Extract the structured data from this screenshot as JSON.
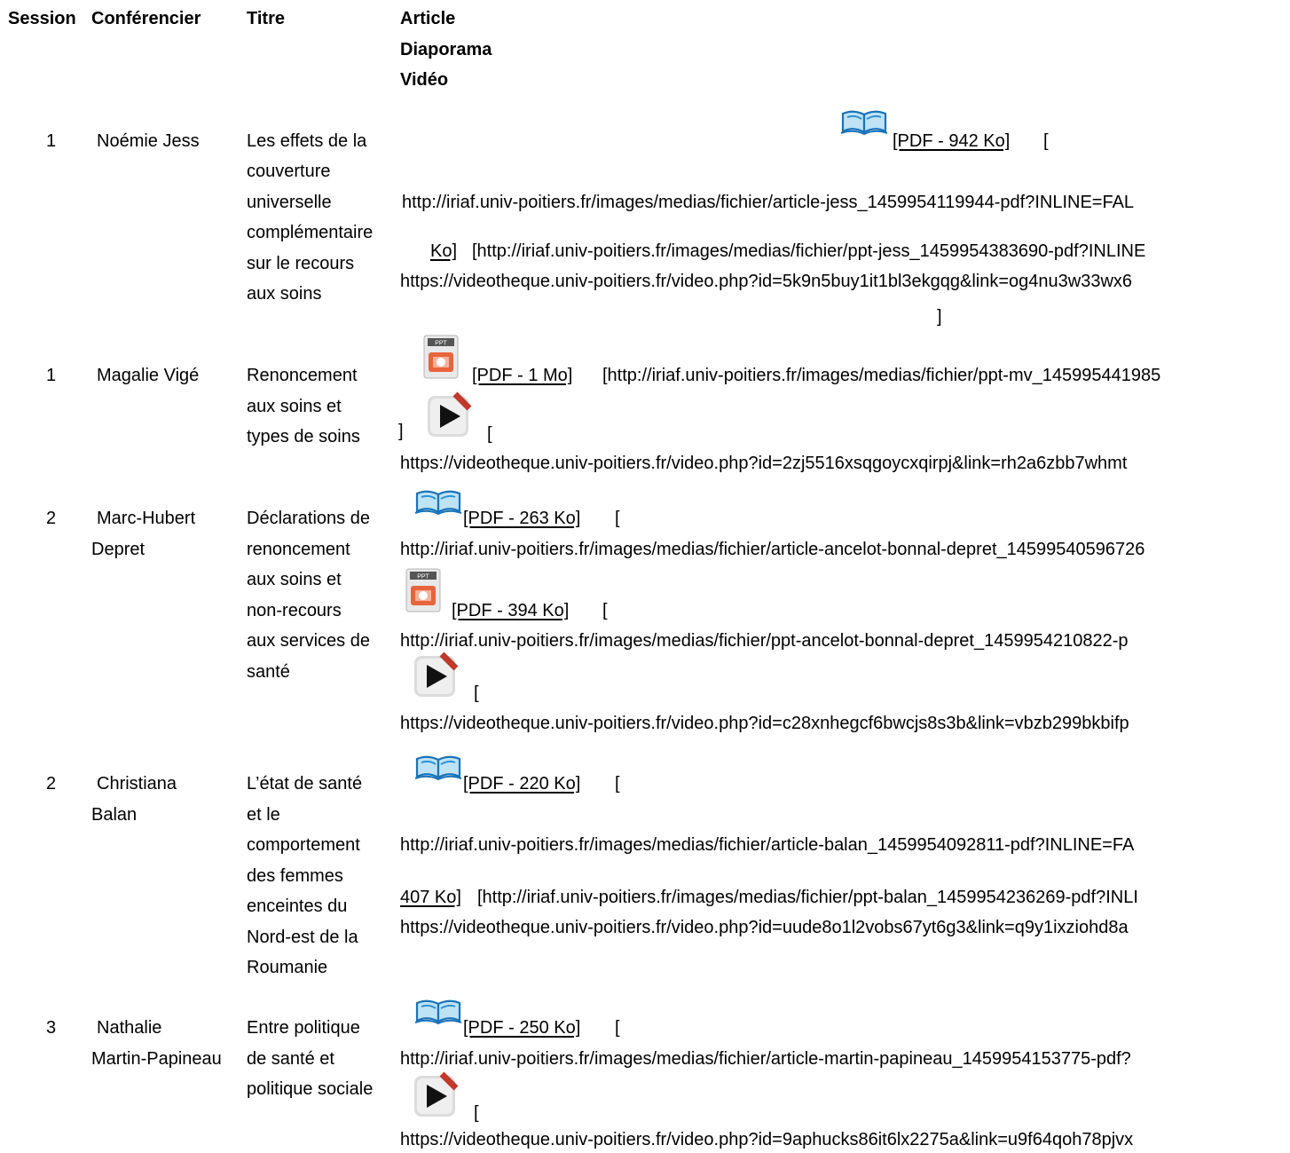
{
  "headers": {
    "session": "Session",
    "speaker": "Conférencier",
    "title": "Titre",
    "media": [
      "Article",
      "Diaporama",
      "Vidéo"
    ]
  },
  "rows": [
    {
      "session": "1",
      "speaker": [
        "Noémie Jess"
      ],
      "title": [
        "Les effets de la",
        "couverture",
        "universelle",
        "complémentaire",
        "sur le recours",
        "aux soins"
      ],
      "lines": {
        "pdf": "[PDF - 942 Ko]",
        "bracket1": "[",
        "url1": "http://iriaf.univ-poitiers.fr/images/medias/fichier/article-jess_1459954119944-pdf?INLINE=FAL",
        "ko": "Ko]",
        "url2": "[http://iriaf.univ-poitiers.fr/images/medias/fichier/ppt-jess_1459954383690-pdf?INLINE",
        "url3": "https://videotheque.univ-poitiers.fr/video.php?id=5k9n5buy1it1bl3ekgqg&link=og4nu3w33wx6",
        "close": "]"
      }
    },
    {
      "session": "1",
      "speaker": [
        "Magalie Vigé"
      ],
      "title": [
        "Renoncement",
        "aux soins et",
        "types de soins"
      ],
      "lines": {
        "pdf": "[PDF - 1 Mo]",
        "url1": "[http://iriaf.univ-poitiers.fr/images/medias/fichier/ppt-mv_145995441985",
        "close": "]",
        "bracket": "[",
        "url2": "https://videotheque.univ-poitiers.fr/video.php?id=2zj5516xsqgoycxqirpj&link=rh2a6zbb7whmt"
      }
    },
    {
      "session": "2",
      "speaker": [
        "Marc-Hubert",
        "Depret"
      ],
      "title": [
        "Déclarations de",
        "renoncement",
        "aux soins et",
        "non-recours",
        "aux services de",
        "santé"
      ],
      "lines": {
        "pdf1": "[PDF - 263 Ko]",
        "b1": "[",
        "url1": "http://iriaf.univ-poitiers.fr/images/medias/fichier/article-ancelot-bonnal-depret_14599540596726",
        "pdf2": "[PDF - 394 Ko]",
        "b2": "[",
        "url2": "http://iriaf.univ-poitiers.fr/images/medias/fichier/ppt-ancelot-bonnal-depret_1459954210822-p",
        "b3": "[",
        "url3": "https://videotheque.univ-poitiers.fr/video.php?id=c28xnhegcf6bwcjs8s3b&link=vbzb299bkbifp"
      }
    },
    {
      "session": "2",
      "speaker": [
        "Christiana",
        "Balan"
      ],
      "title": [
        "L’état de santé",
        "et le",
        "comportement",
        "des femmes",
        "enceintes du",
        "Nord-est de la",
        "Roumanie"
      ],
      "lines": {
        "pdf": "[PDF - 220 Ko]",
        "b1": "[",
        "url1": "http://iriaf.univ-poitiers.fr/images/medias/fichier/article-balan_1459954092811-pdf?INLINE=FA",
        "ko": "407 Ko]",
        "url2": "[http://iriaf.univ-poitiers.fr/images/medias/fichier/ppt-balan_1459954236269-pdf?INLI",
        "url3": "https://videotheque.univ-poitiers.fr/video.php?id=uude8o1l2vobs67yt6g3&link=q9y1ixziohd8a"
      }
    },
    {
      "session": "3",
      "speaker": [
        "Nathalie",
        "Martin-Papineau"
      ],
      "title": [
        "Entre politique",
        "de santé et",
        "politique sociale"
      ],
      "lines": {
        "pdf": "[PDF - 250 Ko]",
        "b1": "[",
        "url1": "http://iriaf.univ-poitiers.fr/images/medias/fichier/article-martin-papineau_1459954153775-pdf?",
        "b2": "[",
        "url2": "https://videotheque.univ-poitiers.fr/video.php?id=9aphucks86it6lx2275a&link=u9f64qoh78pjvx"
      }
    }
  ],
  "icons": {
    "article": "open-book-icon",
    "slides": "ppt-file-icon",
    "video": "video-play-icon"
  }
}
